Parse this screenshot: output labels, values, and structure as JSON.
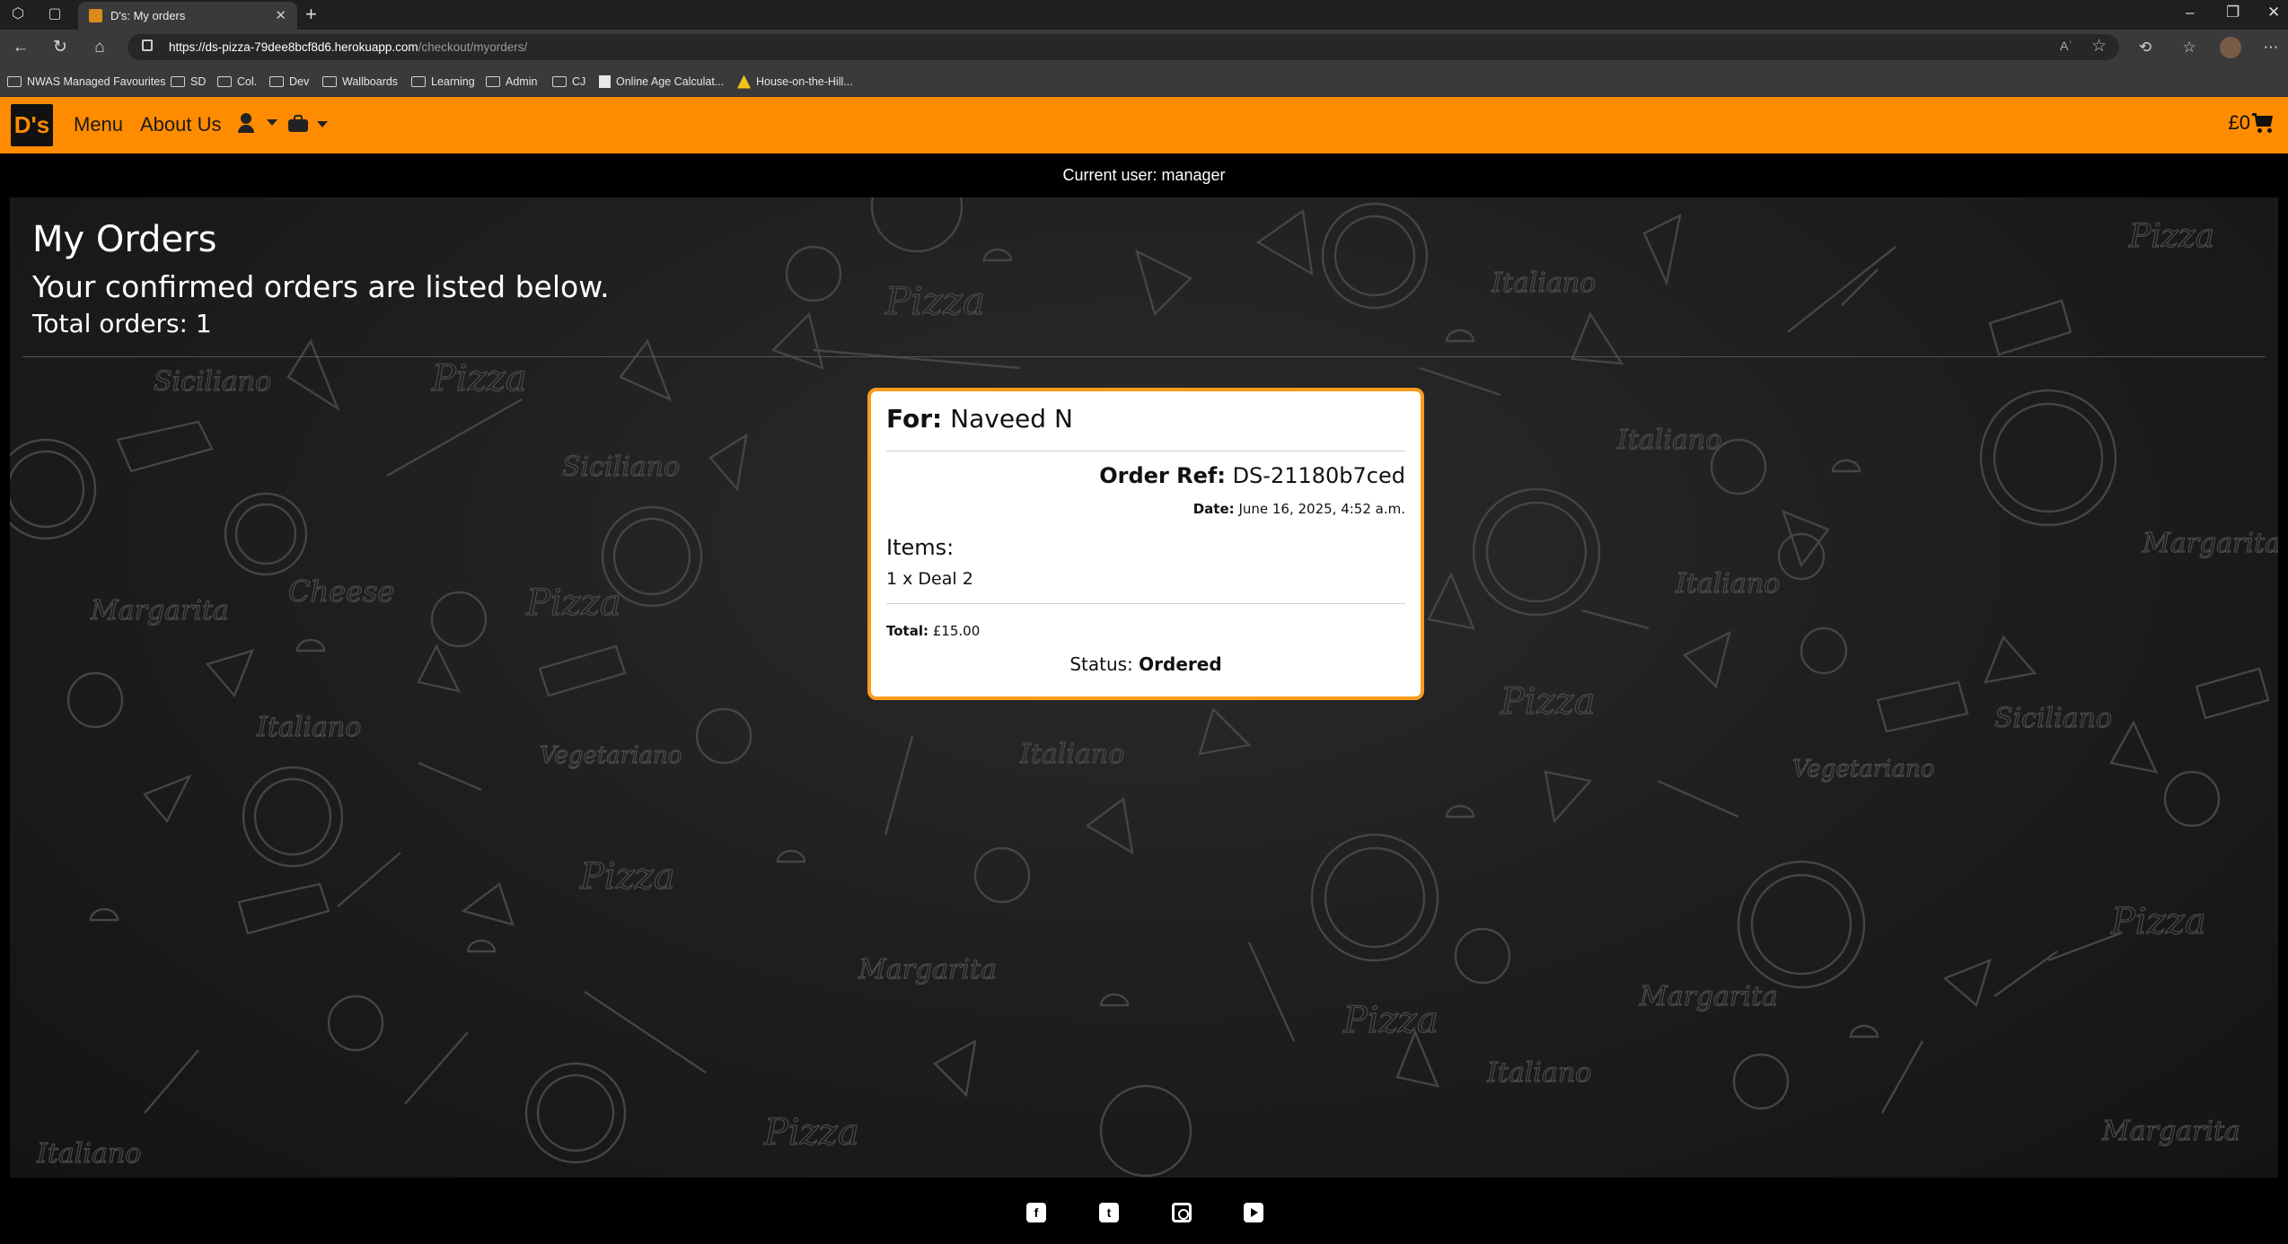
{
  "browser": {
    "tab_title": "D's: My orders",
    "url_host": "https://ds-pizza-79dee8bcf8d6.herokuapp.com",
    "url_path": "/checkout/myorders/",
    "read_aloud": "Aʾ",
    "bookmarks": [
      {
        "label": "NWAS Managed Favourites",
        "icon": "folder-icon"
      },
      {
        "label": "SD",
        "icon": "folder-icon"
      },
      {
        "label": "Col.",
        "icon": "folder-icon"
      },
      {
        "label": "Dev",
        "icon": "folder-icon"
      },
      {
        "label": "Wallboards",
        "icon": "folder-icon"
      },
      {
        "label": "Learning",
        "icon": "folder-icon"
      },
      {
        "label": "Admin",
        "icon": "folder-icon"
      },
      {
        "label": "CJ",
        "icon": "folder-icon"
      },
      {
        "label": "Online Age Calculat...",
        "icon": "page-icon"
      },
      {
        "label": "House-on-the-Hill...",
        "icon": "warning-icon"
      }
    ]
  },
  "site": {
    "logo": "D's",
    "nav": {
      "menu": "Menu",
      "about": "About Us"
    },
    "cart_total": "£0",
    "brand_color": "#ff8c00"
  },
  "user_bar": "Current user: manager",
  "page": {
    "title": "My Orders",
    "subtitle": "Your confirmed orders are listed below.",
    "total_orders": "Total orders: 1"
  },
  "order": {
    "for_label": "For:",
    "for_name": "Naveed N",
    "ref_label": "Order Ref:",
    "ref_value": "DS-21180b7ced",
    "date_label": "Date:",
    "date_value": "June 16, 2025, 4:52 a.m.",
    "items_label": "Items:",
    "items": [
      "1 x Deal 2"
    ],
    "total_label": "Total:",
    "total_value": "£15.00",
    "status_label": "Status:",
    "status_value": "Ordered"
  },
  "background_words": [
    "Pizza",
    "Italiano",
    "Siciliano",
    "Margarita",
    "Cheese",
    "Vegetariano"
  ],
  "footer": {
    "social": [
      "facebook-icon",
      "twitter-icon",
      "instagram-icon",
      "youtube-icon"
    ]
  }
}
